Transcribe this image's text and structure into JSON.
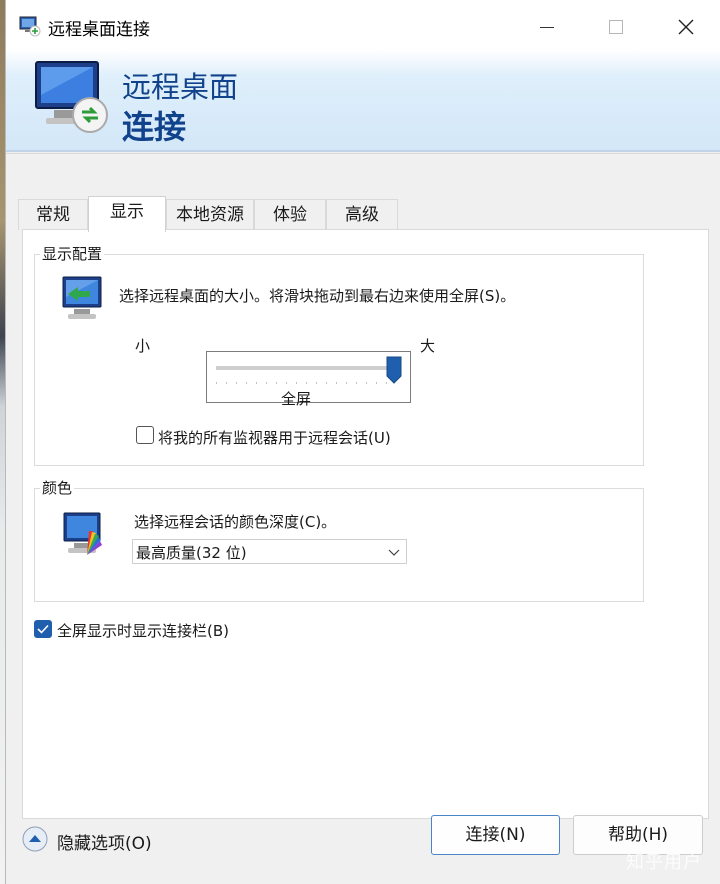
{
  "window": {
    "title": "远程桌面连接",
    "banner_line1": "远程桌面",
    "banner_line2": "连接"
  },
  "tabs": [
    {
      "label": "常规",
      "active": false
    },
    {
      "label": "显示",
      "active": true
    },
    {
      "label": "本地资源",
      "active": false
    },
    {
      "label": "体验",
      "active": false
    },
    {
      "label": "高级",
      "active": false
    }
  ],
  "display_config": {
    "title": "显示配置",
    "description": "选择远程桌面的大小。将滑块拖动到最右边来使用全屏(S)。",
    "slider_min_label": "小",
    "slider_max_label": "大",
    "slider_value_label": "全屏",
    "slider_level_percent": 100,
    "multi_monitor_label": "将我的所有监视器用于远程会话(U)",
    "multi_monitor_checked": false
  },
  "color": {
    "title": "颜色",
    "description": "选择远程会话的颜色深度(C)。",
    "depth_value": "最高质量(32 位)"
  },
  "fullscreen_bar": {
    "label": "全屏显示时显示连接栏(B)",
    "checked": true
  },
  "footer": {
    "hide_options_label": "隐藏选项(O)",
    "connect_label": "连接(N)",
    "help_label": "帮助(H)"
  },
  "watermark": "知乎用户",
  "colors": {
    "accent": "#1f5fad",
    "banner_text": "#10438c",
    "header_gradient": "#d3e7f8"
  }
}
